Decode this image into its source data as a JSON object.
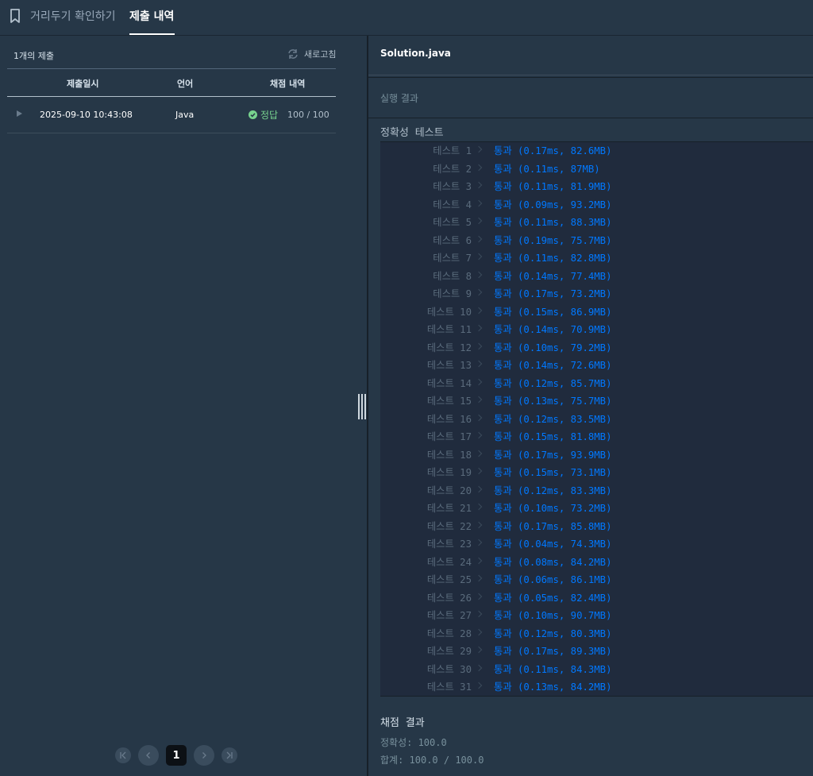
{
  "tabs": {
    "bookmark": "거리두기 확인하기",
    "submissions": "제출 내역"
  },
  "submissions": {
    "count_label": "1개의 제출",
    "refresh_label": "새로고침",
    "columns": {
      "date": "제출일시",
      "language": "언어",
      "result": "채점 내역"
    },
    "rows": [
      {
        "date": "2025-09-10 10:43:08",
        "language": "Java",
        "status": "정답",
        "score": "100 / 100"
      }
    ]
  },
  "pagination": {
    "current": "1"
  },
  "editor": {
    "filename": "Solution.java"
  },
  "execution": {
    "title": "실행 결과"
  },
  "accuracy": {
    "title": "정확성  테스트",
    "tests": [
      {
        "label": "테스트 1",
        "result": "통과 (0.17ms, 82.6MB)"
      },
      {
        "label": "테스트 2",
        "result": "통과 (0.11ms, 87MB)"
      },
      {
        "label": "테스트 3",
        "result": "통과 (0.11ms, 81.9MB)"
      },
      {
        "label": "테스트 4",
        "result": "통과 (0.09ms, 93.2MB)"
      },
      {
        "label": "테스트 5",
        "result": "통과 (0.11ms, 88.3MB)"
      },
      {
        "label": "테스트 6",
        "result": "통과 (0.19ms, 75.7MB)"
      },
      {
        "label": "테스트 7",
        "result": "통과 (0.11ms, 82.8MB)"
      },
      {
        "label": "테스트 8",
        "result": "통과 (0.14ms, 77.4MB)"
      },
      {
        "label": "테스트 9",
        "result": "통과 (0.17ms, 73.2MB)"
      },
      {
        "label": "테스트 10",
        "result": "통과 (0.15ms, 86.9MB)"
      },
      {
        "label": "테스트 11",
        "result": "통과 (0.14ms, 70.9MB)"
      },
      {
        "label": "테스트 12",
        "result": "통과 (0.10ms, 79.2MB)"
      },
      {
        "label": "테스트 13",
        "result": "통과 (0.14ms, 72.6MB)"
      },
      {
        "label": "테스트 14",
        "result": "통과 (0.12ms, 85.7MB)"
      },
      {
        "label": "테스트 15",
        "result": "통과 (0.13ms, 75.7MB)"
      },
      {
        "label": "테스트 16",
        "result": "통과 (0.12ms, 83.5MB)"
      },
      {
        "label": "테스트 17",
        "result": "통과 (0.15ms, 81.8MB)"
      },
      {
        "label": "테스트 18",
        "result": "통과 (0.17ms, 93.9MB)"
      },
      {
        "label": "테스트 19",
        "result": "통과 (0.15ms, 73.1MB)"
      },
      {
        "label": "테스트 20",
        "result": "통과 (0.12ms, 83.3MB)"
      },
      {
        "label": "테스트 21",
        "result": "통과 (0.10ms, 73.2MB)"
      },
      {
        "label": "테스트 22",
        "result": "통과 (0.17ms, 85.8MB)"
      },
      {
        "label": "테스트 23",
        "result": "통과 (0.04ms, 74.3MB)"
      },
      {
        "label": "테스트 24",
        "result": "통과 (0.08ms, 84.2MB)"
      },
      {
        "label": "테스트 25",
        "result": "통과 (0.06ms, 86.1MB)"
      },
      {
        "label": "테스트 26",
        "result": "통과 (0.05ms, 82.4MB)"
      },
      {
        "label": "테스트 27",
        "result": "통과 (0.10ms, 90.7MB)"
      },
      {
        "label": "테스트 28",
        "result": "통과 (0.12ms, 80.3MB)"
      },
      {
        "label": "테스트 29",
        "result": "통과 (0.17ms, 89.3MB)"
      },
      {
        "label": "테스트 30",
        "result": "통과 (0.11ms, 84.3MB)"
      },
      {
        "label": "테스트 31",
        "result": "통과 (0.13ms, 84.2MB)"
      }
    ]
  },
  "grading": {
    "title": "채점  결과",
    "accuracy": "정확성: 100.0",
    "total": "합계: 100.0 / 100.0"
  }
}
